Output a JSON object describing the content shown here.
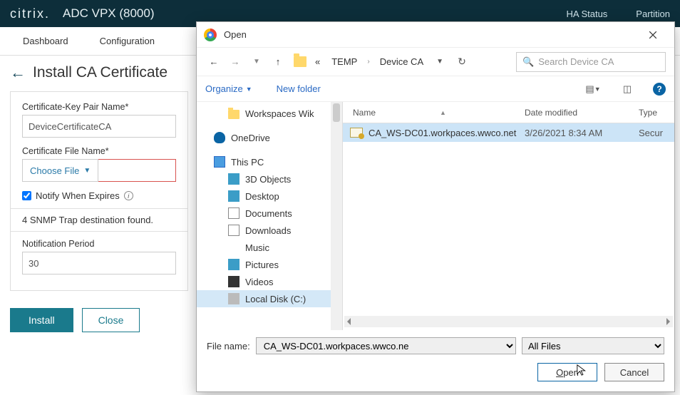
{
  "header": {
    "logo": "citrix.",
    "product": "ADC VPX (8000)",
    "ha_status": "HA Status",
    "partition": "Partition"
  },
  "tabs": {
    "dashboard": "Dashboard",
    "configuration": "Configuration"
  },
  "page": {
    "title": "Install CA Certificate",
    "cert_pair_label": "Certificate-Key Pair Name*",
    "cert_pair_value": "DeviceCertificateCA",
    "cert_file_label": "Certificate File Name*",
    "choose_file": "Choose File",
    "notify_label": "Notify When Expires",
    "snmp_msg": "4 SNMP Trap destination found.",
    "notif_period_label": "Notification Period",
    "notif_period_value": "30",
    "install_btn": "Install",
    "close_btn": "Close"
  },
  "dialog": {
    "title": "Open",
    "breadcrumb": {
      "sep": "«",
      "p1": "TEMP",
      "p2": "Device CA"
    },
    "search_placeholder": "Search Device CA",
    "organize": "Organize",
    "new_folder": "New folder",
    "tree": {
      "workspaces": "Workspaces Wik",
      "onedrive": "OneDrive",
      "thispc": "This PC",
      "threeD": "3D Objects",
      "desktop": "Desktop",
      "documents": "Documents",
      "downloads": "Downloads",
      "music": "Music",
      "pictures": "Pictures",
      "videos": "Videos",
      "localdisk": "Local Disk (C:)"
    },
    "columns": {
      "name": "Name",
      "date": "Date modified",
      "type": "Type"
    },
    "file": {
      "name": "CA_WS-DC01.workpaces.wwco.net",
      "date": "3/26/2021 8:34 AM",
      "type": "Secur"
    },
    "filename_label": "File name:",
    "filename_value": "CA_WS-DC01.workpaces.wwco.ne",
    "filter": "All Files",
    "open_btn": "Open",
    "cancel_btn": "Cancel"
  }
}
